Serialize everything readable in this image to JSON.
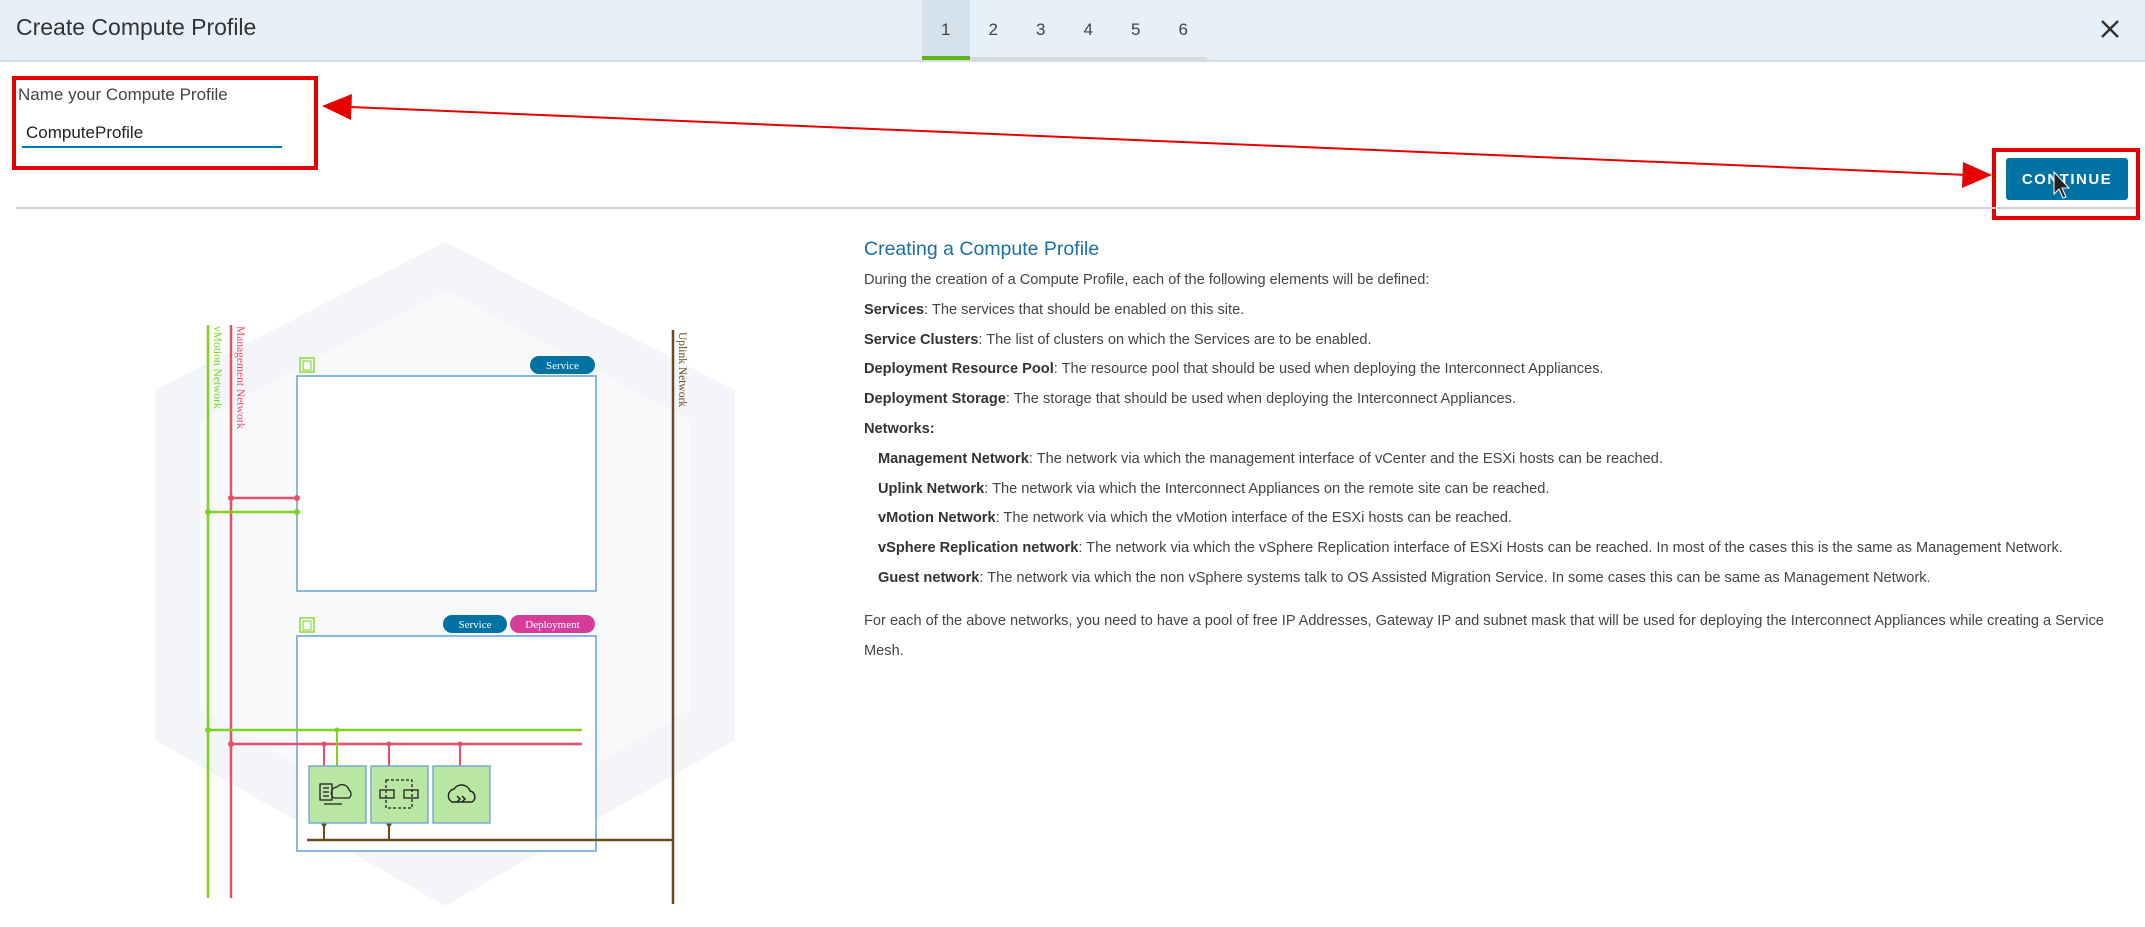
{
  "header": {
    "title": "Create Compute Profile",
    "steps": [
      "1",
      "2",
      "3",
      "4",
      "5",
      "6"
    ],
    "active_step": "1"
  },
  "form": {
    "name_label": "Name your Compute Profile",
    "name_value": "ComputeProfile"
  },
  "continue_label": "CONTINUE",
  "diagram": {
    "vmotion_label": "vMotion Network",
    "management_label": "Management Network",
    "uplink_label": "Uplink Network",
    "service_badge": "Service",
    "service_badge_2": "Service",
    "deployment_badge": "Deployment"
  },
  "info": {
    "title": "Creating a Compute Profile",
    "intro": "During the creation of a Compute Profile, each of the following elements will be defined:",
    "items": [
      {
        "term": "Services",
        "desc": ": The services that should be enabled on this site."
      },
      {
        "term": "Service Clusters",
        "desc": ": The list of clusters on which the Services are to be enabled."
      },
      {
        "term": "Deployment Resource Pool",
        "desc": ": The resource pool that should be used when deploying the Interconnect Appliances."
      },
      {
        "term": "Deployment Storage",
        "desc": ": The storage that should be used when deploying the Interconnect Appliances."
      }
    ],
    "networks_heading": "Networks:",
    "networks": [
      {
        "term": "Management Network",
        "desc": ": The network via which the management interface of vCenter and the ESXi hosts can be reached."
      },
      {
        "term": "Uplink Network",
        "desc": ": The network via which the Interconnect Appliances on the remote site can be reached."
      },
      {
        "term": "vMotion Network",
        "desc": ": The network via which the vMotion interface of the ESXi hosts can be reached."
      },
      {
        "term": "vSphere Replication network",
        "desc": ": The network via which the vSphere Replication interface of ESXi Hosts can be reached. In most of the cases this is the same as Management Network."
      },
      {
        "term": "Guest network",
        "desc": ": The network via which the non vSphere systems talk to OS Assisted Migration Service. In some cases this can be same as Management Network."
      }
    ],
    "footer": "For each of the above networks, you need to have a pool of free IP Addresses, Gateway IP and subnet mask that will be used for deploying the Interconnect Appliances while creating a Service Mesh."
  },
  "colors": {
    "header_bg": "#e6f0f8",
    "accent_blue": "#0072a3",
    "active_step_green": "#60b515",
    "annotation_red": "#e60000",
    "vmotion_green": "#7ed321",
    "management_red": "#e8506a",
    "uplink_brown": "#6b4a1e",
    "deployment_pink": "#d63d9a"
  }
}
